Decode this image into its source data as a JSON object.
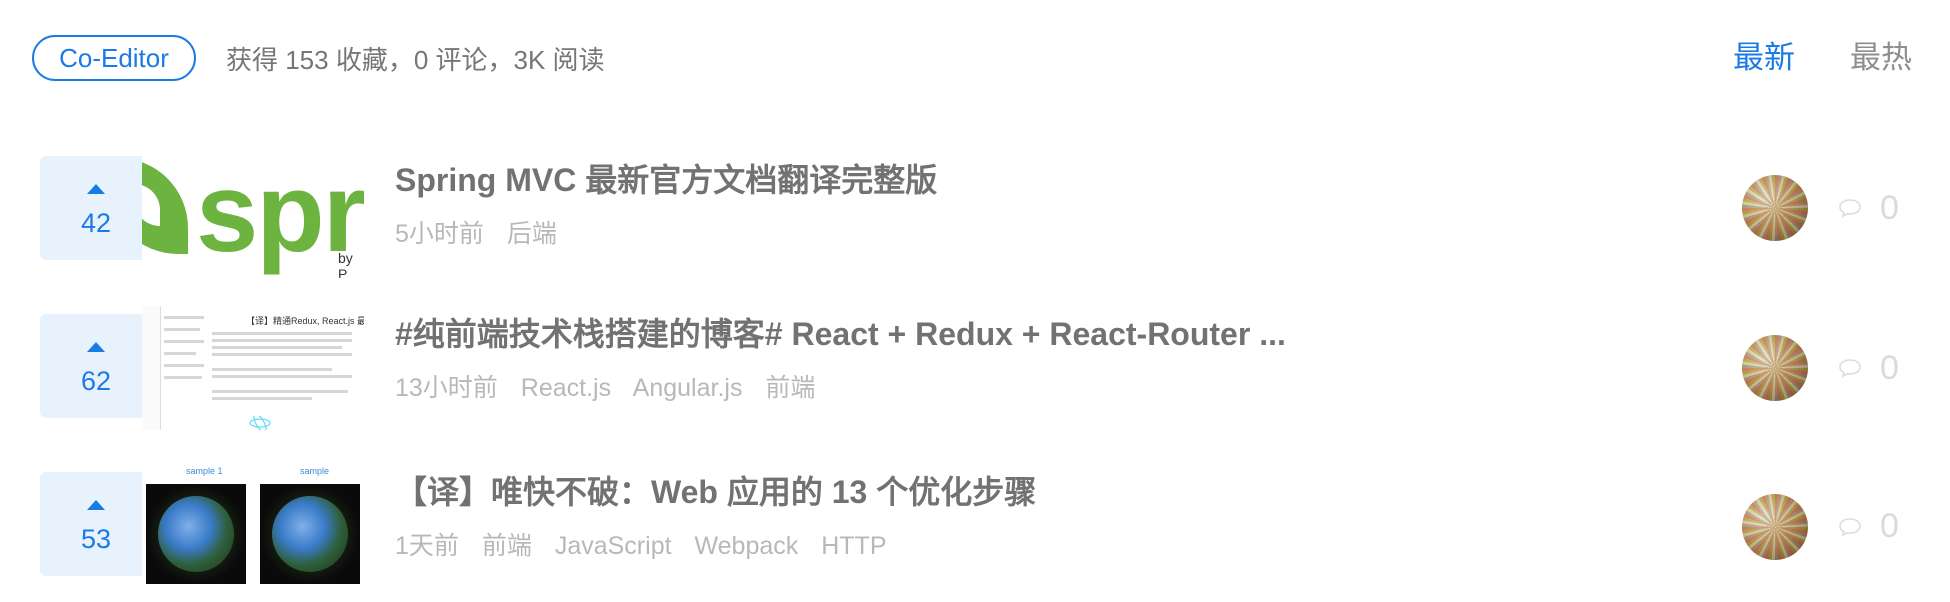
{
  "header": {
    "badge_label": "Co-Editor",
    "stats_text": "获得 153 收藏，0 评论，3K 阅读",
    "sort_tabs": [
      {
        "label": "最新",
        "active": true
      },
      {
        "label": "最热",
        "active": false
      }
    ]
  },
  "colors": {
    "accent": "#1b7be6",
    "vote_bg": "#e8f2fd",
    "title": "#727272",
    "meta": "#b8b8b8",
    "spring_green": "#6db33f"
  },
  "articles": [
    {
      "votes": "42",
      "thumbnail": "spring-logo",
      "thumbnail_text": "sprin",
      "thumbnail_by": "by P",
      "title": "Spring MVC 最新官方文档翻译完整版",
      "time": "5小时前",
      "tags": [
        "后端"
      ],
      "comments": "0"
    },
    {
      "votes": "62",
      "thumbnail": "document-screenshot",
      "thumbnail_text": "【译】精通Redux, React.js 最佳实践",
      "title": "#纯前端技术栈搭建的博客# React + Redux + React-Router ...",
      "time": "13小时前",
      "tags": [
        "React.js",
        "Angular.js",
        "前端"
      ],
      "comments": "0"
    },
    {
      "votes": "53",
      "thumbnail": "earth-images",
      "thumbnail_labels": [
        "sample 1",
        "sample"
      ],
      "title": "【译】唯快不破：Web 应用的 13 个优化步骤",
      "time": "1天前",
      "tags": [
        "前端",
        "JavaScript",
        "Webpack",
        "HTTP"
      ],
      "comments": "0"
    }
  ],
  "icons": {
    "upvote": "triangle-up-icon",
    "comment": "speech-bubble-icon"
  }
}
